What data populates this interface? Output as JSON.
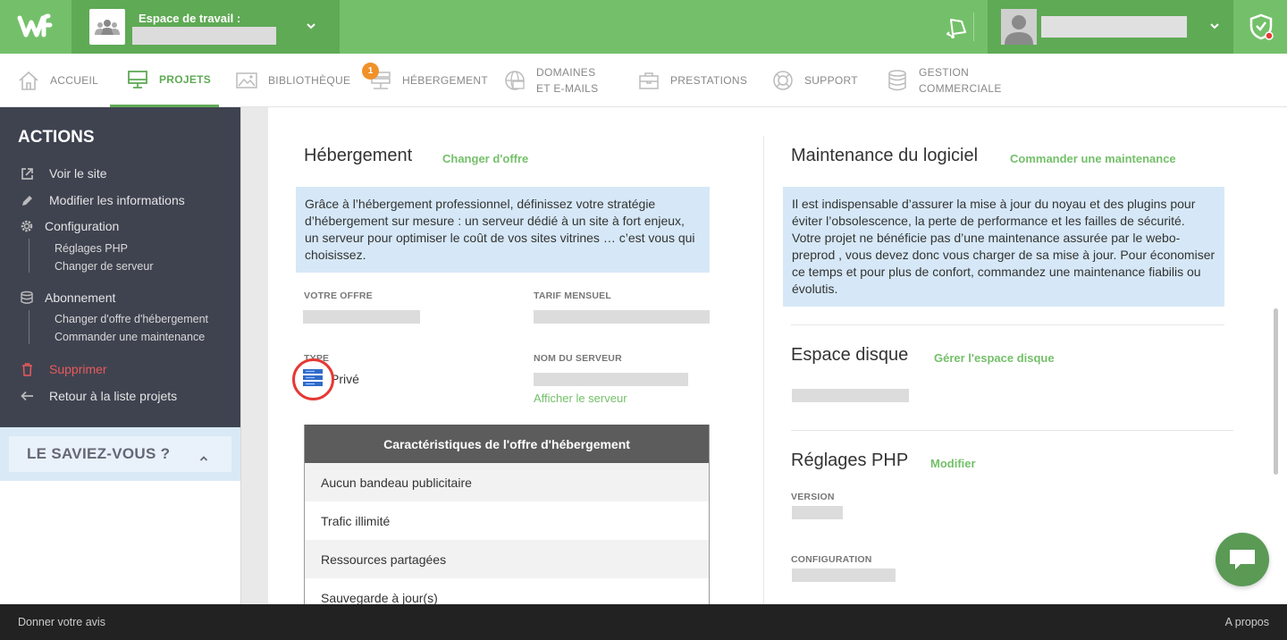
{
  "workspace": {
    "label": "Espace de travail :"
  },
  "nav": {
    "items": [
      {
        "label": "ACCUEIL"
      },
      {
        "label": "PROJETS"
      },
      {
        "label": "BIBLIOTHÈQUE"
      },
      {
        "label": "HÉBERGEMENT",
        "badge": "1"
      },
      {
        "label_line1": "DOMAINES",
        "label_line2": "ET E-MAILS"
      },
      {
        "label": "PRESTATIONS"
      },
      {
        "label": "SUPPORT"
      },
      {
        "label_line1": "GESTION",
        "label_line2": "COMMERCIALE"
      }
    ]
  },
  "sidebar": {
    "title": "ACTIONS",
    "items": {
      "voir": "Voir le site",
      "modifier": "Modifier les informations",
      "configuration": "Configuration",
      "reglages_php": "Réglages PHP",
      "changer_serveur": "Changer de serveur",
      "abonnement": "Abonnement",
      "changer_offre": "Changer d'offre d'hébergement",
      "commander": "Commander une maintenance",
      "supprimer": "Supprimer",
      "retour": "Retour à la liste projets"
    },
    "saviez": "LE SAVIEZ-VOUS ?"
  },
  "hebergement": {
    "title": "Hébergement",
    "link": "Changer d'offre",
    "info": "Grâce à l’hébergement professionnel, définissez votre stratégie d’hébergement sur mesure : un serveur dédié à un site à fort enjeux, un serveur pour optimiser le coût de vos sites vitrines … c’est vous qui choisissez.",
    "votre_offre_label": "VOTRE OFFRE",
    "tarif_label": "TARIF MENSUEL",
    "type_label": "TYPE",
    "type_value": "Privé",
    "serveur_label": "NOM DU SERVEUR",
    "afficher_serveur": "Afficher le serveur",
    "table": {
      "header": "Caractéristiques de l'offre d'hébergement",
      "rows": [
        "Aucun bandeau publicitaire",
        "Trafic illimité",
        "Ressources partagées",
        "Sauvegarde à jour(s)"
      ]
    }
  },
  "maintenance": {
    "title": "Maintenance du logiciel",
    "link": "Commander une maintenance",
    "info": "Il est indispensable d’assurer la mise à jour du noyau et des plugins pour éviter l’obsolescence, la perte de performance et les failles de sécurité. Votre projet ne bénéficie pas d’une maintenance assurée par le webo-preprod , vous devez donc vous charger de sa mise à jour. Pour économiser ce temps et pour plus de confort, commandez une maintenance fiabilis ou évolutis."
  },
  "espace": {
    "title": "Espace disque",
    "link": "Gérer l'espace disque"
  },
  "php": {
    "title": "Réglages PHP",
    "link": "Modifier",
    "version_label": "VERSION",
    "config_label": "CONFIGURATION"
  },
  "footer": {
    "left": "Donner votre avis",
    "right": "A propos"
  },
  "colors": {
    "green": "#74c06a",
    "dark_green": "#5faa55",
    "sidebar_bg": "#3f4350",
    "info_bg": "#d6e8f7",
    "danger": "#e85a5a",
    "highlight": "#e53935"
  }
}
